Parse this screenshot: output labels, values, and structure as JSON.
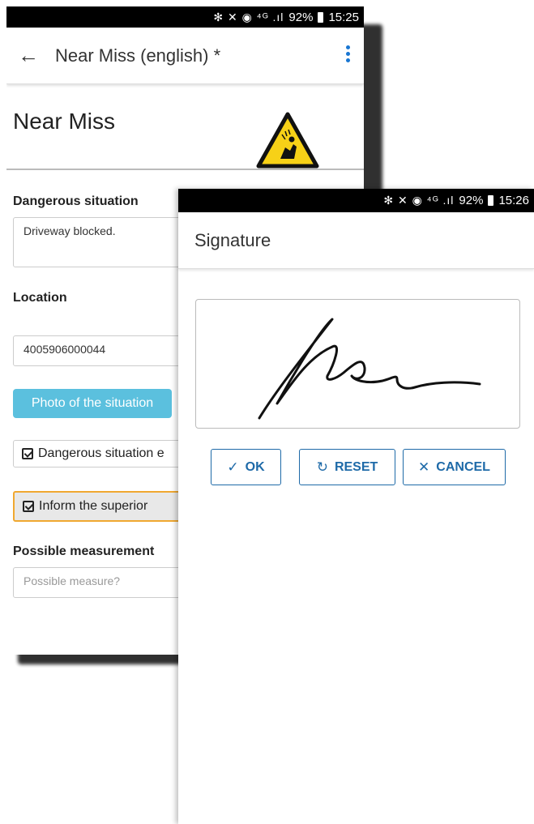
{
  "back": {
    "status": {
      "battery": "92%",
      "time": "15:25"
    },
    "appbar": {
      "title": "Near Miss (english) *"
    },
    "header": {
      "title": "Near Miss"
    },
    "dangerous_situation": {
      "label": "Dangerous situation",
      "value": "Driveway blocked."
    },
    "location": {
      "label": "Location",
      "value": "4005906000044"
    },
    "photo_button": "Photo of the situation",
    "check1": "Dangerous situation e",
    "check2": "Inform the superior",
    "possible": {
      "label": "Possible measurement",
      "placeholder": "Possible measure?"
    }
  },
  "front": {
    "status": {
      "battery": "92%",
      "time": "15:26"
    },
    "title": "Signature",
    "buttons": {
      "ok": "OK",
      "reset": "RESET",
      "cancel": "CANCEL"
    }
  }
}
